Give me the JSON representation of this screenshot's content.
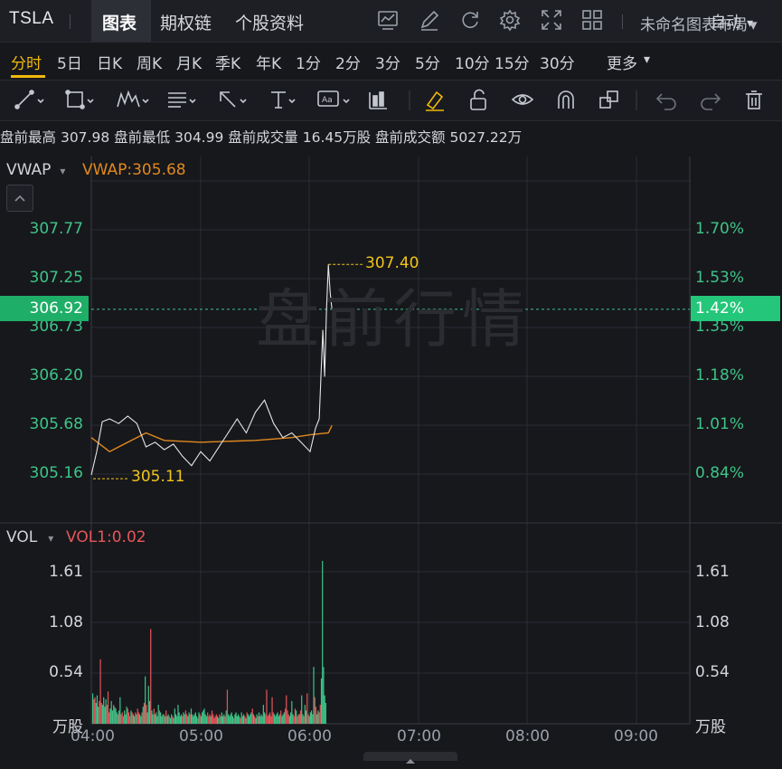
{
  "header": {
    "ticker": "TSLA",
    "tabs": [
      {
        "label": "图表",
        "active": true
      },
      {
        "label": "期权链",
        "active": false
      },
      {
        "label": "个股资料",
        "active": false
      }
    ],
    "toolbar_icons": [
      "chart-icon",
      "edit-icon",
      "refresh-icon",
      "gear-icon",
      "fullscreen-icon",
      "grid-layout-icon"
    ],
    "layout_name": "未命名图表布局"
  },
  "periods": {
    "items": [
      "分时",
      "5日",
      "日K",
      "周K",
      "月K",
      "季K",
      "年K",
      "1分",
      "2分",
      "3分",
      "5分",
      "10分",
      "15分",
      "30分",
      "更多"
    ],
    "active": "分时",
    "more_arrow": "▾",
    "auto_label": "自动",
    "auto_arrow": "▾"
  },
  "drawing_tools": [
    "trend-line-icon",
    "rectangle-icon",
    "pattern-icon",
    "fib-icon",
    "arrow-icon",
    "text-icon",
    "annotation-icon",
    "bar-pattern-icon",
    "highlighter-icon",
    "unlock-icon",
    "eye-icon",
    "magnet-icon",
    "clone-icon",
    "undo-icon",
    "redo-icon",
    "trash-icon"
  ],
  "info": {
    "premarket_high_label": "盘前最高",
    "premarket_high": "307.98",
    "premarket_low_label": "盘前最低",
    "premarket_low": "304.99",
    "premarket_volume_label": "盘前成交量",
    "premarket_volume": "16.45万股",
    "premarket_turnover_label": "盘前成交额",
    "premarket_turnover": "5027.22万"
  },
  "price_panel": {
    "indicator_name": "VWAP",
    "indicator_value": "VWAP:305.68",
    "dropdown_arrow": "▾",
    "current_price": "306.92",
    "current_pct": "1.42%",
    "high_marker": "307.40",
    "low_marker": "305.11",
    "watermark": "盘前行情",
    "left_ticks": [
      "307.77",
      "307.25",
      "306.73",
      "306.20",
      "305.68",
      "305.16"
    ],
    "right_ticks": [
      "1.70%",
      "1.53%",
      "1.35%",
      "1.18%",
      "1.01%",
      "0.84%"
    ]
  },
  "volume_panel": {
    "indicator_name": "VOL",
    "indicator_value": "VOL1:0.02",
    "dropdown_arrow": "▾",
    "left_ticks": [
      "1.61",
      "1.08",
      "0.54",
      "万股"
    ],
    "right_ticks": [
      "1.61",
      "1.08",
      "0.54",
      "万股"
    ]
  },
  "time_axis": [
    "04:00",
    "05:00",
    "06:00",
    "07:00",
    "08:00",
    "09:00"
  ],
  "colors": {
    "up": "#3ec488",
    "down": "#e5565b",
    "accent": "#f0b90b",
    "vwap": "#e0891e",
    "price_line": "#e6e6e6",
    "vol_indicator": "#e5565b"
  },
  "chart_data": [
    {
      "type": "line",
      "series": [
        {
          "name": "VWAP",
          "color": "#e0891e",
          "x": [
            "04:00",
            "04:10",
            "04:30",
            "04:40",
            "05:00",
            "05:30",
            "05:50",
            "06:00",
            "06:10",
            "06:12"
          ],
          "values": [
            305.55,
            305.4,
            305.6,
            305.52,
            305.5,
            305.52,
            305.55,
            305.58,
            305.6,
            305.68
          ]
        },
        {
          "color": "#e6e6e6",
          "x": [
            "04:00",
            "04:03",
            "04:06",
            "04:10",
            "04:15",
            "04:20",
            "04:25",
            "04:30",
            "04:35",
            "04:40",
            "04:45",
            "04:50",
            "04:55",
            "05:00",
            "05:05",
            "05:10",
            "05:15",
            "05:20",
            "05:25",
            "05:30",
            "05:35",
            "05:40",
            "05:45",
            "05:50",
            "05:55",
            "06:00",
            "06:03",
            "06:05",
            "06:07",
            "06:08",
            "06:09",
            "06:10",
            "06:11",
            "06:12"
          ],
          "values": [
            305.15,
            305.4,
            305.72,
            305.75,
            305.7,
            305.78,
            305.7,
            305.45,
            305.5,
            305.42,
            305.48,
            305.35,
            305.25,
            305.4,
            305.3,
            305.45,
            305.6,
            305.75,
            305.6,
            305.82,
            305.95,
            305.7,
            305.55,
            305.6,
            305.5,
            305.4,
            305.65,
            305.75,
            306.7,
            306.2,
            306.9,
            307.4,
            307.1,
            306.92
          ]
        }
      ],
      "ylim": [
        304.92,
        307.98
      ],
      "xlim": [
        "04:00",
        "09:30"
      ],
      "annotations": [
        "307.40",
        "305.11"
      ]
    },
    {
      "type": "bar",
      "title": "VOL",
      "ylabel": "万股",
      "ylim": [
        0,
        1.9
      ],
      "bars_per_minute": true,
      "values": [
        0.32,
        0.26,
        0.28,
        0.22,
        0.3,
        0.18,
        0.24,
        0.68,
        0.22,
        0.2,
        0.28,
        0.18,
        0.26,
        0.2,
        0.34,
        0.12,
        0.16,
        0.24,
        0.14,
        0.2,
        0.18,
        0.16,
        0.12,
        0.1,
        0.14,
        0.28,
        0.1,
        0.12,
        0.08,
        0.14,
        0.1,
        0.18,
        0.16,
        0.12,
        0.08,
        0.14,
        0.12,
        0.1,
        0.08,
        0.12,
        0.1,
        0.16,
        0.12,
        0.1,
        0.08,
        0.12,
        0.18,
        0.22,
        0.5,
        0.2,
        0.12,
        0.4,
        0.24,
        1.0,
        0.14,
        0.1,
        0.16,
        0.1,
        0.12,
        0.08,
        0.2,
        0.14,
        0.12,
        0.08,
        0.1,
        0.1,
        0.08,
        0.14,
        0.08,
        0.1,
        0.08,
        0.06,
        0.1,
        0.08,
        0.06,
        0.16,
        0.1,
        0.08,
        0.2,
        0.12,
        0.08,
        0.1,
        0.08,
        0.12,
        0.1,
        0.14,
        0.1,
        0.08,
        0.12,
        0.1,
        0.16,
        0.1,
        0.08,
        0.1,
        0.12,
        0.08,
        0.06,
        0.12,
        0.1,
        0.08,
        0.12,
        0.14,
        0.16,
        0.1,
        0.08,
        0.12,
        0.08,
        0.1,
        0.08,
        0.14,
        0.1,
        0.06,
        0.08,
        0.1,
        0.08,
        0.06,
        0.1,
        0.08,
        0.12,
        0.08,
        0.1,
        0.08,
        0.14,
        0.36,
        0.1,
        0.08,
        0.1,
        0.12,
        0.08,
        0.06,
        0.1,
        0.12,
        0.08,
        0.1,
        0.08,
        0.06,
        0.12,
        0.08,
        0.1,
        0.08,
        0.06,
        0.12,
        0.1,
        0.08,
        0.1,
        0.12,
        0.16,
        0.1,
        0.08,
        0.06,
        0.1,
        0.08,
        0.12,
        0.08,
        0.1,
        0.08,
        0.2,
        0.12,
        0.1,
        0.36,
        0.08,
        0.1,
        0.12,
        0.08,
        0.28,
        0.12,
        0.1,
        0.08,
        0.1,
        0.12,
        0.08,
        0.1,
        0.14,
        0.08,
        0.1,
        0.12,
        0.16,
        0.3,
        0.14,
        0.1,
        0.08,
        0.12,
        0.24,
        0.1,
        0.08,
        0.16,
        0.14,
        0.08,
        0.1,
        0.1,
        0.14,
        0.3,
        0.1,
        0.08,
        0.2,
        0.14,
        0.32,
        0.1,
        0.08,
        0.12,
        0.14,
        0.1,
        0.6,
        0.28,
        0.18,
        0.1,
        0.14,
        0.12,
        0.2,
        0.48,
        1.72,
        0.6,
        0.3,
        0.22
      ],
      "colors_up_down": "alternating per candle"
    }
  ]
}
